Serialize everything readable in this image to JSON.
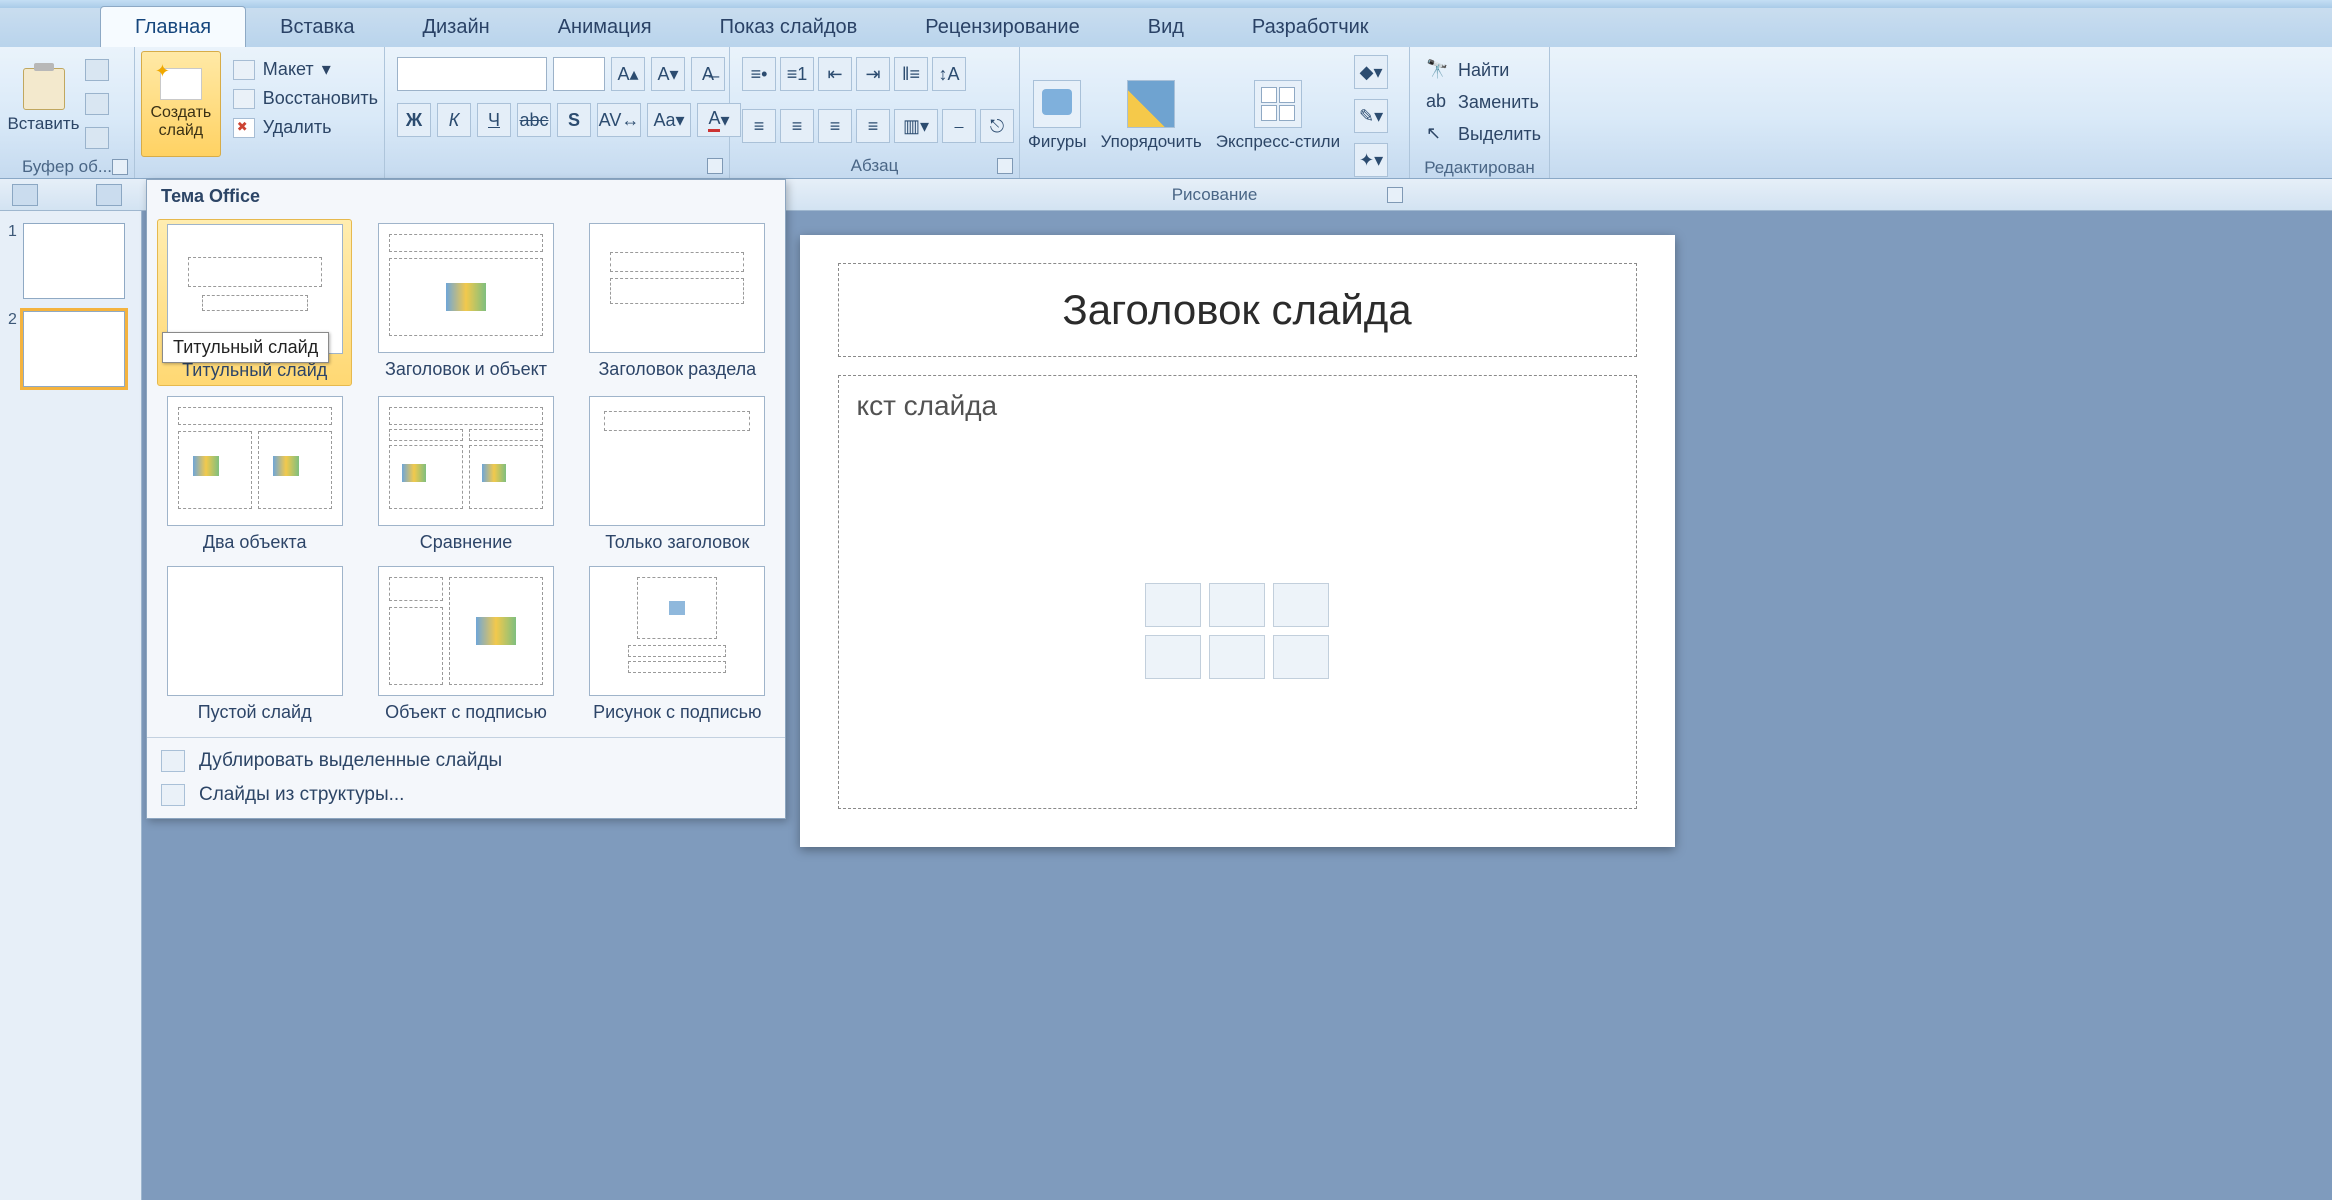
{
  "tabs": [
    "Главная",
    "Вставка",
    "Дизайн",
    "Анимация",
    "Показ слайдов",
    "Рецензирование",
    "Вид",
    "Разработчик"
  ],
  "active_tab": 0,
  "clipboard": {
    "paste": "Вставить",
    "caption": "Буфер об..."
  },
  "slides_group": {
    "new_slide": "Создать слайд",
    "layout": "Макет",
    "reset": "Восстановить",
    "delete": "Удалить"
  },
  "paragraph_caption": "Абзац",
  "drawing": {
    "shapes": "Фигуры",
    "arrange": "Упорядочить",
    "styles": "Экспресс-стили",
    "caption": "Рисование"
  },
  "editing": {
    "find": "Найти",
    "replace": "Заменить",
    "select": "Выделить",
    "caption": "Редактирован"
  },
  "gallery": {
    "header": "Тема Office",
    "layouts": [
      "Титульный слайд",
      "Заголовок и объект",
      "Заголовок раздела",
      "Два объекта",
      "Сравнение",
      "Только заголовок",
      "Пустой слайд",
      "Объект с подписью",
      "Рисунок с подписью"
    ],
    "tooltip": "Титульный слайд",
    "footer": {
      "duplicate": "Дублировать выделенные слайды",
      "outline": "Слайды из структуры..."
    }
  },
  "slide_canvas": {
    "title": "Заголовок слайда",
    "body_hint": "кст слайда"
  },
  "thumbs": [
    "1",
    "2"
  ]
}
